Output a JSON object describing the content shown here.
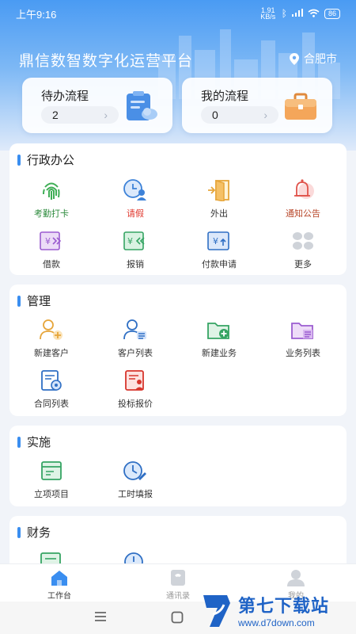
{
  "status_bar": {
    "time": "上午9:16",
    "speed": "1.91 KB/s",
    "battery": "86"
  },
  "header": {
    "title": "鼎信数智数字化运营平台",
    "location": "合肥市"
  },
  "flow_cards": [
    {
      "label": "待办流程",
      "count": "2"
    },
    {
      "label": "我的流程",
      "count": "0"
    }
  ],
  "sections": {
    "admin": {
      "title": "行政办公",
      "items": [
        {
          "label": "考勤打卡",
          "icon": "fingerprint-icon"
        },
        {
          "label": "请假",
          "icon": "leave-clock-icon"
        },
        {
          "label": "外出",
          "icon": "go-out-door-icon"
        },
        {
          "label": "通知公告",
          "icon": "bell-icon"
        },
        {
          "label": "借款",
          "icon": "loan-icon"
        },
        {
          "label": "报销",
          "icon": "reimburse-icon"
        },
        {
          "label": "付款申请",
          "icon": "payment-icon"
        },
        {
          "label": "更多",
          "icon": "more-grid-icon"
        }
      ]
    },
    "manage": {
      "title": "管理",
      "items": [
        {
          "label": "新建客户",
          "icon": "add-customer-icon"
        },
        {
          "label": "客户列表",
          "icon": "customer-list-icon"
        },
        {
          "label": "新建业务",
          "icon": "add-business-icon"
        },
        {
          "label": "业务列表",
          "icon": "business-list-icon"
        },
        {
          "label": "合同列表",
          "icon": "contract-list-icon"
        },
        {
          "label": "投标报价",
          "icon": "bid-quote-icon"
        }
      ]
    },
    "implement": {
      "title": "实施",
      "items": [
        {
          "label": "立项项目",
          "icon": "project-icon"
        },
        {
          "label": "工时填报",
          "icon": "timesheet-icon"
        }
      ]
    },
    "finance": {
      "title": "财务"
    }
  },
  "tabbar": [
    {
      "label": "工作台"
    },
    {
      "label": "通讯录"
    },
    {
      "label": "我的"
    }
  ],
  "watermark": {
    "name": "第七下载站",
    "url": "www.d7down.com"
  },
  "colors": {
    "accent": "#3a8ef0",
    "header_top": "#4a9bf3"
  }
}
